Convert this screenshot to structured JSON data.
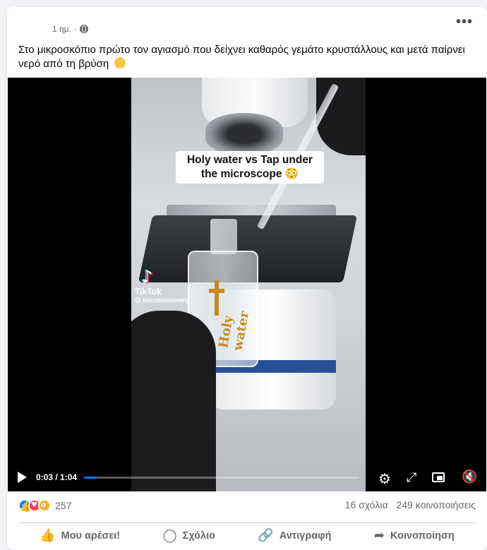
{
  "post": {
    "timestamp": "1 ημ.",
    "separator": "·",
    "more_label": "•••",
    "caption": "Στο μικροσκόπιο πρώτο τον αγιασμό που δείχνει καθαρός γεμάτο κρυστάλλους και μετά παίρνει νερό από τη βρύση"
  },
  "video": {
    "overlay_title_line1": "Holy water vs Tap under",
    "overlay_title_line2": "the microscope 😳",
    "bottle_label": "Holy water",
    "tiktok_name": "TikTok",
    "tiktok_handle": "@ microozooming",
    "time_display": "0:03 / 1:04",
    "progress_fraction": 0.047
  },
  "stats": {
    "reaction_count": "257",
    "comments": "16 σχόλια",
    "shares": "249 κοινοποιήσεις"
  },
  "actions": [
    {
      "label": "Μου αρέσει!",
      "icon": "thumbs-up-icon"
    },
    {
      "label": "Σχόλιο",
      "icon": "comment-icon"
    },
    {
      "label": "Αντιγραφή",
      "icon": "link-icon"
    },
    {
      "label": "Κοινοποίηση",
      "icon": "share-icon"
    }
  ],
  "colors": {
    "accent": "#1b74e4",
    "love": "#f33e58",
    "wow": "#f7b125",
    "text_secondary": "#65676b"
  }
}
